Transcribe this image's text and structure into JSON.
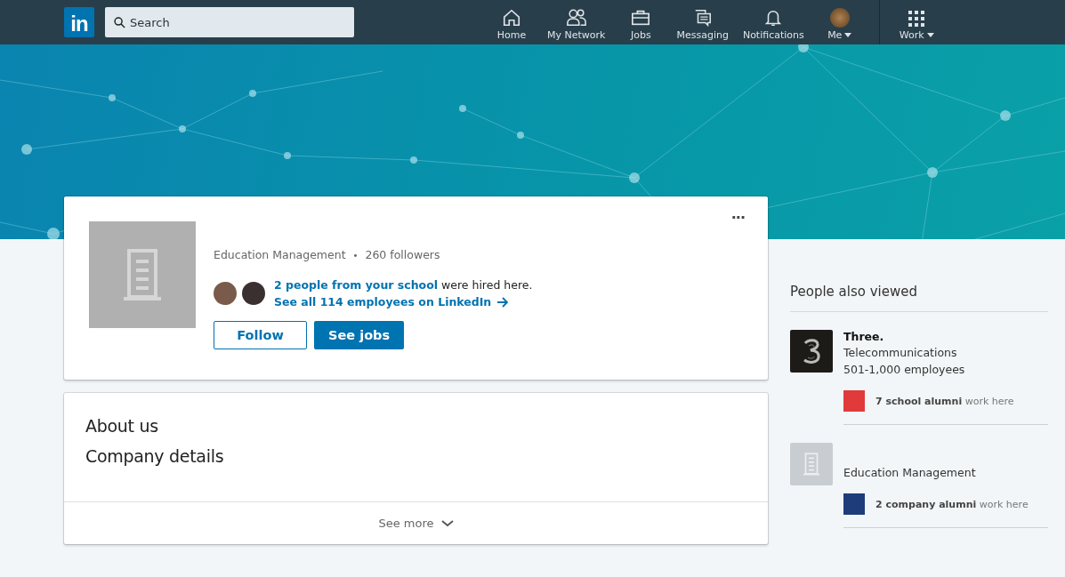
{
  "nav": {
    "logo": "in",
    "search": {
      "placeholder": "Search"
    },
    "items": [
      {
        "kind": "home",
        "label": "Home"
      },
      {
        "kind": "network",
        "label": "My Network"
      },
      {
        "kind": "jobs",
        "label": "Jobs"
      },
      {
        "kind": "messaging",
        "label": "Messaging"
      },
      {
        "kind": "notifications",
        "label": "Notifications"
      },
      {
        "kind": "me",
        "label": "Me"
      },
      {
        "kind": "work",
        "label": "Work"
      }
    ]
  },
  "company": {
    "more": "···",
    "industry": "Education Management",
    "separator": "•",
    "followers": "260 followers",
    "hired_link": "2 people from your school",
    "hired_rest": "were hired here.",
    "employees_link": "See all 114 employees on LinkedIn",
    "buttons": [
      {
        "kind": "outline",
        "label": "Follow"
      },
      {
        "kind": "primary",
        "label": "See jobs"
      }
    ]
  },
  "about": {
    "title": "About us",
    "details": "Company details",
    "see_more": "See more"
  },
  "people_also_viewed": {
    "title": "People also viewed",
    "items": [
      {
        "kind": "three",
        "name": "Three.",
        "industry": "Telecommunications",
        "size": "501-1,000 employees",
        "alumni_bold": "7 school alumni",
        "alumni_rest": "work here"
      },
      {
        "kind": "generic",
        "industry": "Education Management",
        "alumni_bold": "2 company alumni",
        "alumni_rest": "work here"
      }
    ]
  }
}
